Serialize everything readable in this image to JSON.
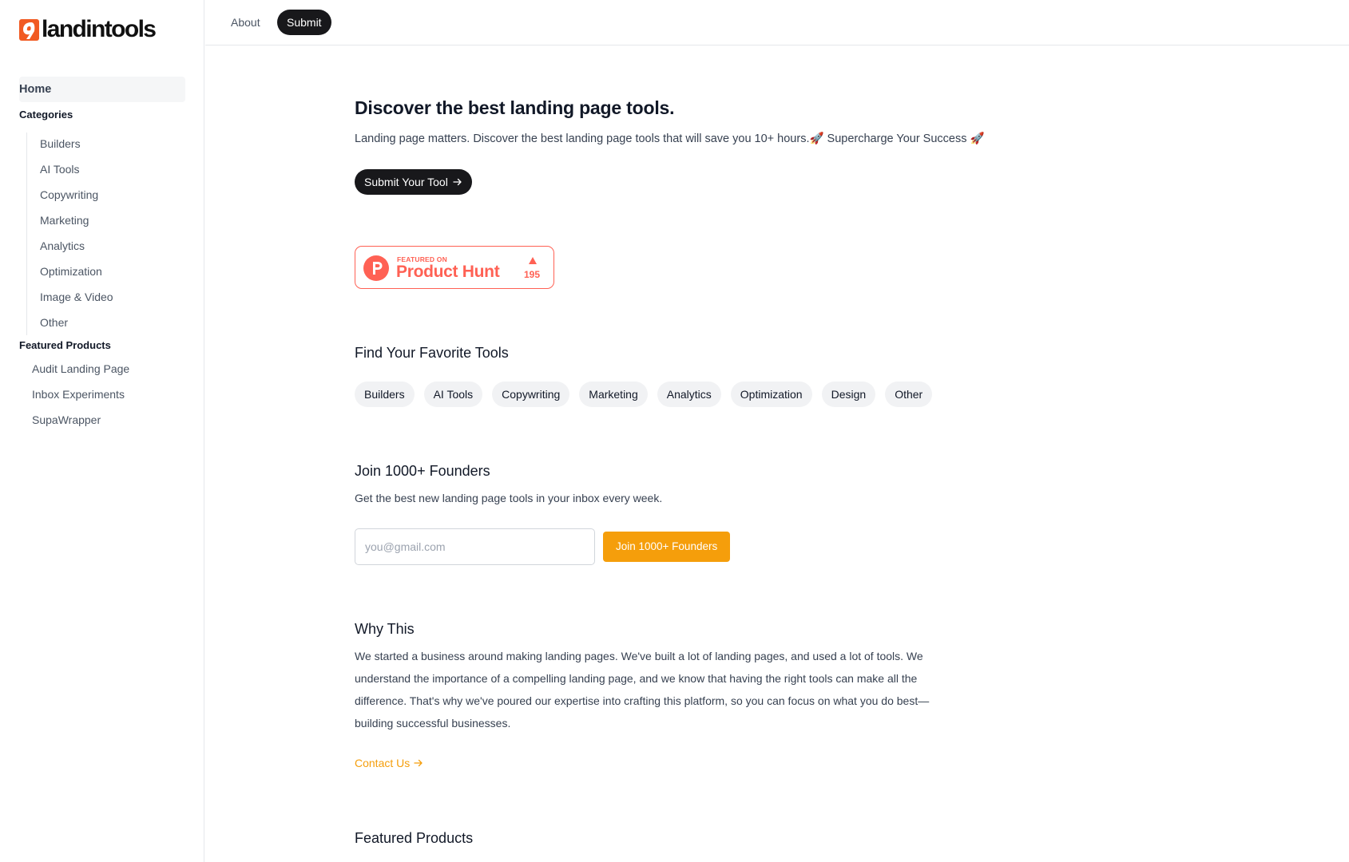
{
  "brand": {
    "name": "landintools",
    "accent_color": "#f15a22"
  },
  "sidebar": {
    "home": "Home",
    "categories_title": "Categories",
    "categories": [
      "Builders",
      "AI Tools",
      "Copywriting",
      "Marketing",
      "Analytics",
      "Optimization",
      "Image & Video",
      "Other"
    ],
    "featured_title": "Featured Products",
    "featured": [
      "Audit Landing Page",
      "Inbox Experiments",
      "SupaWrapper"
    ]
  },
  "topbar": {
    "about": "About",
    "submit": "Submit"
  },
  "hero": {
    "title": "Discover the best landing page tools.",
    "subtitle": "Landing page matters. Discover the best landing page tools that will save you 10+ hours.🚀 Supercharge Your Success 🚀",
    "cta": "Submit Your Tool",
    "cta_icon": "arrow-right-icon"
  },
  "product_hunt": {
    "small": "FEATURED ON",
    "big": "Product Hunt",
    "count": "195",
    "color": "#ff6154"
  },
  "tools_section": {
    "title": "Find Your Favorite Tools",
    "chips": [
      "Builders",
      "AI Tools",
      "Copywriting",
      "Marketing",
      "Analytics",
      "Optimization",
      "Design",
      "Other"
    ]
  },
  "newsletter": {
    "title": "Join 1000+ Founders",
    "subtitle": "Get the best new landing page tools in your inbox every week.",
    "placeholder": "you@gmail.com",
    "button": "Join 1000+ Founders",
    "button_color": "#f59e0b"
  },
  "why": {
    "title": "Why This",
    "body": "We started a business around making landing pages. We've built a lot of landing pages, and used a lot of tools. We understand the importance of a compelling landing page, and we know that having the right tools can make all the difference. That's why we've poured our expertise into crafting this platform, so you can focus on what you do best—building successful businesses.",
    "contact": "Contact Us"
  },
  "featured_section": {
    "title": "Featured Products"
  }
}
